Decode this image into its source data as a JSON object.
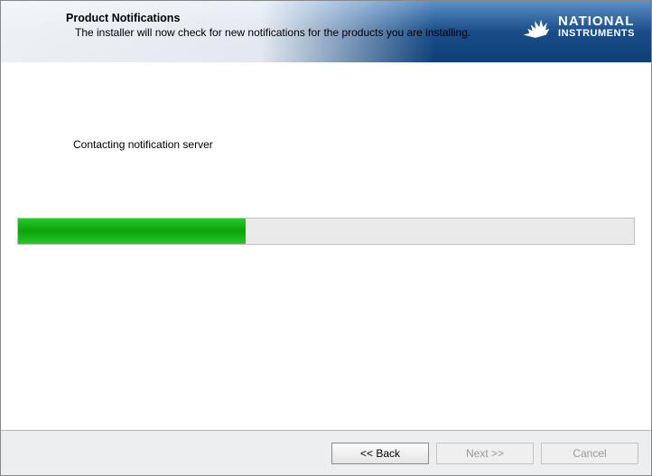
{
  "header": {
    "title": "Product Notifications",
    "subtitle": "The installer will now check for new notifications for the products you are installing."
  },
  "brand": {
    "line1": "NATIONAL",
    "line2": "INSTRUMENTS"
  },
  "content": {
    "status": "Contacting notification server",
    "progress_percent": 37
  },
  "buttons": {
    "back": "<< Back",
    "next": "Next >>",
    "cancel": "Cancel"
  },
  "button_states": {
    "back_enabled": true,
    "next_enabled": false,
    "cancel_enabled": false
  }
}
